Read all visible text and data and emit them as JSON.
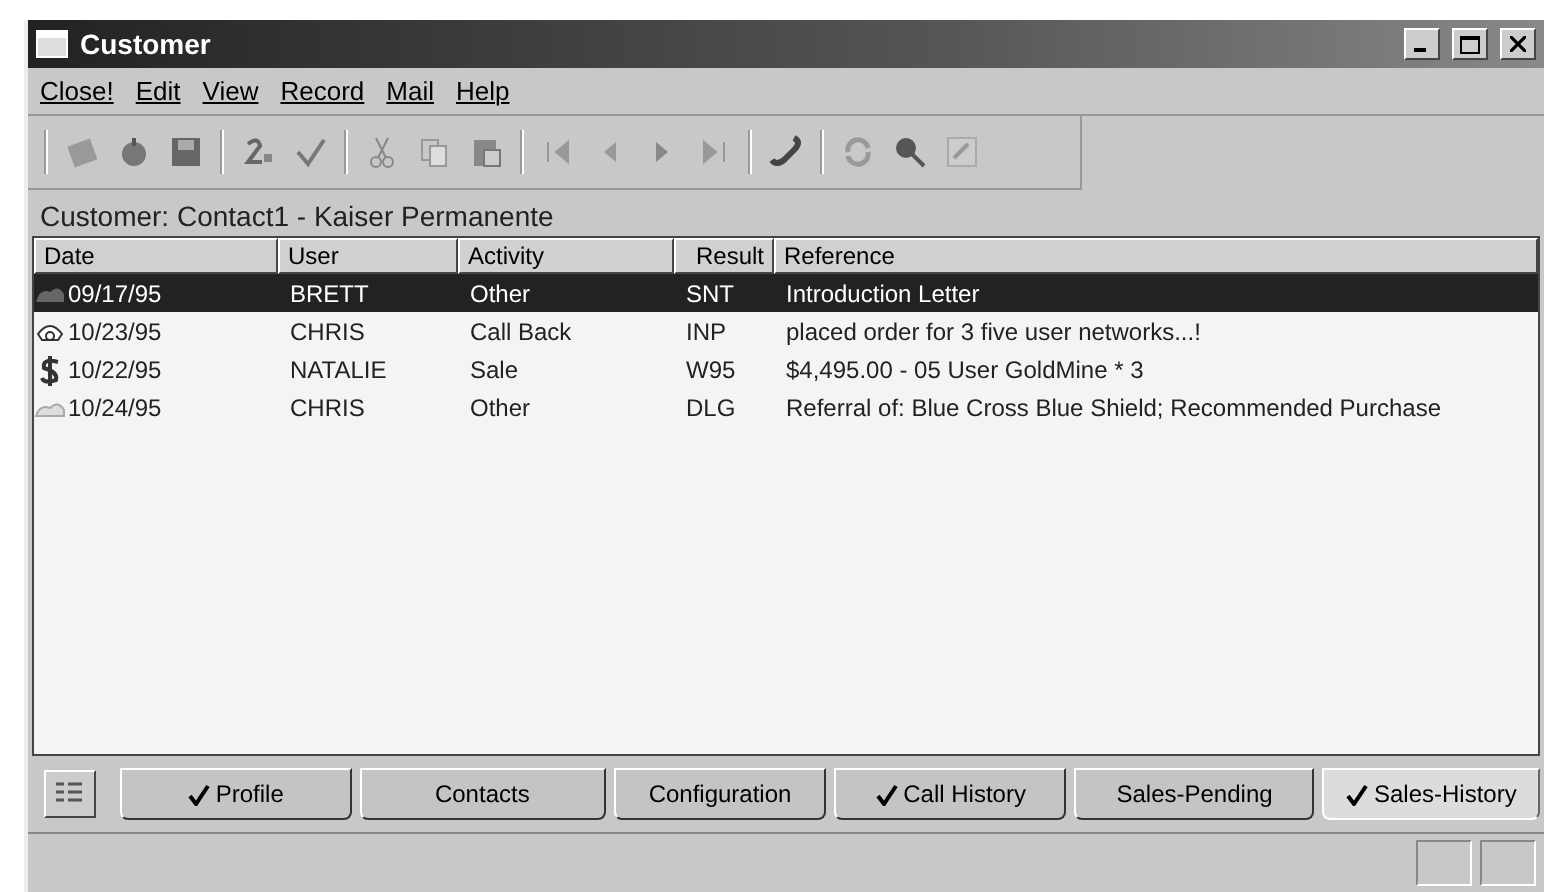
{
  "window": {
    "title": "Customer"
  },
  "menu": [
    "Close!",
    "Edit",
    "View",
    "Record",
    "Mail",
    "Help"
  ],
  "record_label": "Customer: Contact1 - Kaiser Permanente",
  "table": {
    "columns": [
      "Date",
      "User",
      "Activity",
      "Result",
      "Reference"
    ],
    "rows": [
      {
        "kind": "letter",
        "selected": true,
        "cells": [
          "09/17/95",
          "BRETT",
          "Other",
          "SNT",
          "Introduction Letter"
        ]
      },
      {
        "kind": "phone",
        "selected": false,
        "cells": [
          "10/23/95",
          "CHRIS",
          "Call Back",
          "INP",
          "placed order for 3 five user networks...!"
        ]
      },
      {
        "kind": "sale",
        "selected": false,
        "cells": [
          "10/22/95",
          "NATALIE",
          "Sale",
          "W95",
          "$4,495.00 - 05 User GoldMine * 3"
        ]
      },
      {
        "kind": "letter-faded",
        "selected": false,
        "cells": [
          "10/24/95",
          "CHRIS",
          "Other",
          "DLG",
          "Referral of: Blue Cross Blue Shield; Recommended Purchase"
        ]
      }
    ]
  },
  "tabs": [
    {
      "label": "Profile",
      "checked": true,
      "selected": false
    },
    {
      "label": "Contacts",
      "checked": false,
      "selected": false
    },
    {
      "label": "Configuration",
      "checked": false,
      "selected": false
    },
    {
      "label": "Call History",
      "checked": true,
      "selected": false
    },
    {
      "label": "Sales-Pending",
      "checked": false,
      "selected": false
    },
    {
      "label": "Sales-History",
      "checked": true,
      "selected": true
    }
  ]
}
